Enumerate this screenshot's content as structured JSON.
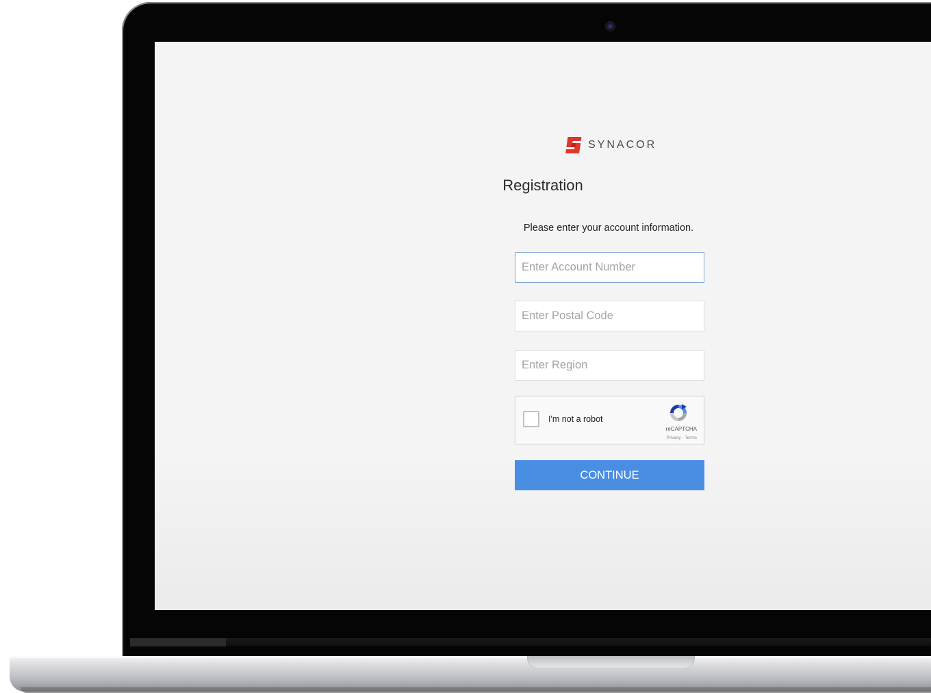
{
  "brand": {
    "name": "SYNACOR",
    "logo_icon": "synacor-logo-icon",
    "logo_color": "#e0362c"
  },
  "page": {
    "title": "Registration",
    "instructions": "Please enter your account information."
  },
  "form": {
    "account_number": {
      "placeholder": "Enter Account Number",
      "value": ""
    },
    "postal_code": {
      "placeholder": "Enter Postal Code",
      "value": ""
    },
    "region": {
      "placeholder": "Enter Region",
      "value": ""
    }
  },
  "recaptcha": {
    "label": "I'm not a robot",
    "brand": "reCAPTCHA",
    "links": "Privacy - Terms",
    "checked": false
  },
  "continue_button": {
    "label": "CONTINUE",
    "color": "#4a8ee4"
  }
}
